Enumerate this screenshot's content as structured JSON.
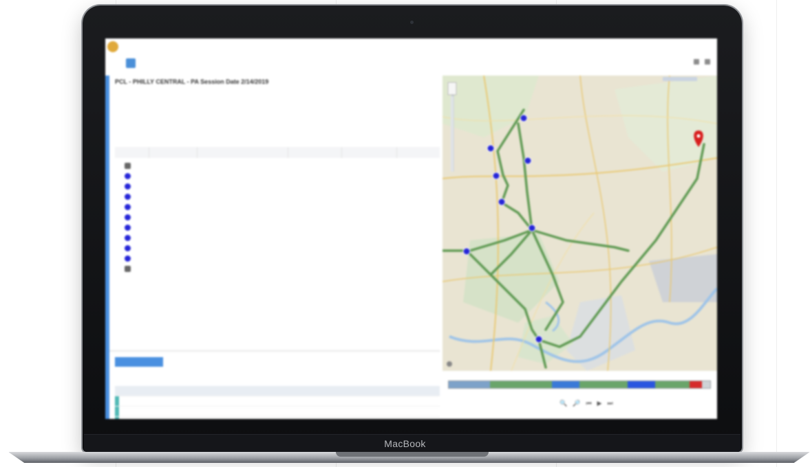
{
  "laptop": {
    "brand": "MacBook"
  },
  "app": {
    "title": "",
    "user": "",
    "tabs": [
      {
        "label": ""
      },
      {
        "label": ""
      },
      {
        "label": ""
      }
    ],
    "toolbar": {
      "reset_label": "",
      "filter_label": "",
      "export_label": ""
    }
  },
  "route": {
    "heading": "PCL - PHILLY CENTRAL - PA    Session Date 2/14/2019",
    "info": [
      {
        "value": "",
        "label": ""
      },
      {
        "value": "",
        "label": ""
      },
      {
        "value": "",
        "label": ""
      },
      {
        "value": "",
        "label": ""
      },
      {
        "value": "",
        "label": ""
      },
      {
        "value": "",
        "label": ""
      },
      {
        "value": "",
        "label": "",
        "alert": true
      },
      {
        "value": "",
        "label": ""
      },
      {
        "value": "",
        "label": ""
      },
      {
        "value": "",
        "label": ""
      }
    ]
  },
  "stops_table": {
    "columns": [
      "",
      "",
      "",
      "",
      ""
    ],
    "rows": [
      {
        "id": "",
        "desc": "",
        "arrive": "",
        "depart": "",
        "status": "neutral"
      },
      {
        "id": "",
        "desc": "",
        "arrive": "",
        "depart": "",
        "status": "ok"
      },
      {
        "id": "",
        "desc": "",
        "arrive": "",
        "depart": "",
        "status": "ok"
      },
      {
        "id": "",
        "desc": "",
        "arrive": "",
        "depart": "",
        "status": "late"
      },
      {
        "id": "",
        "desc": "",
        "arrive": "",
        "depart": "",
        "status": "late"
      },
      {
        "id": "",
        "desc": "",
        "arrive": "",
        "depart": "",
        "status": "late"
      },
      {
        "id": "",
        "desc": "",
        "arrive": "",
        "depart": "",
        "status": "late"
      },
      {
        "id": "",
        "desc": "",
        "arrive": "",
        "depart": "",
        "status": "late"
      },
      {
        "id": "",
        "desc": "",
        "arrive": "",
        "depart": "",
        "status": "late"
      },
      {
        "id": "",
        "desc": "",
        "arrive": "",
        "depart": "",
        "status": "late"
      },
      {
        "id": "",
        "desc": "",
        "arrive": "",
        "depart": "",
        "status": "neutral"
      }
    ]
  },
  "alerts": {
    "tab_label": "",
    "filters": [
      "",
      "",
      "",
      ""
    ],
    "rows": [
      {
        "type": "",
        "time": "",
        "detail": ""
      },
      {
        "type": "",
        "time": "",
        "detail": ""
      },
      {
        "type": "",
        "time": "",
        "detail": ""
      },
      {
        "type": "",
        "time": "",
        "detail": ""
      },
      {
        "type": "",
        "time": "",
        "detail": ""
      },
      {
        "type": "",
        "time": "",
        "detail": ""
      }
    ]
  },
  "map": {
    "legend": ""
  },
  "timeline": {
    "ticks": [
      "",
      "",
      "",
      "",
      "",
      "",
      "",
      "",
      ""
    ],
    "label": ""
  },
  "colors": {
    "accent": "#4a90e0",
    "route": "#5f9a53",
    "stop_marker": "#2626d8",
    "ok_text": "#2e9a3a",
    "late_text": "#e03b3b",
    "destination_marker": "#d81e1e"
  }
}
